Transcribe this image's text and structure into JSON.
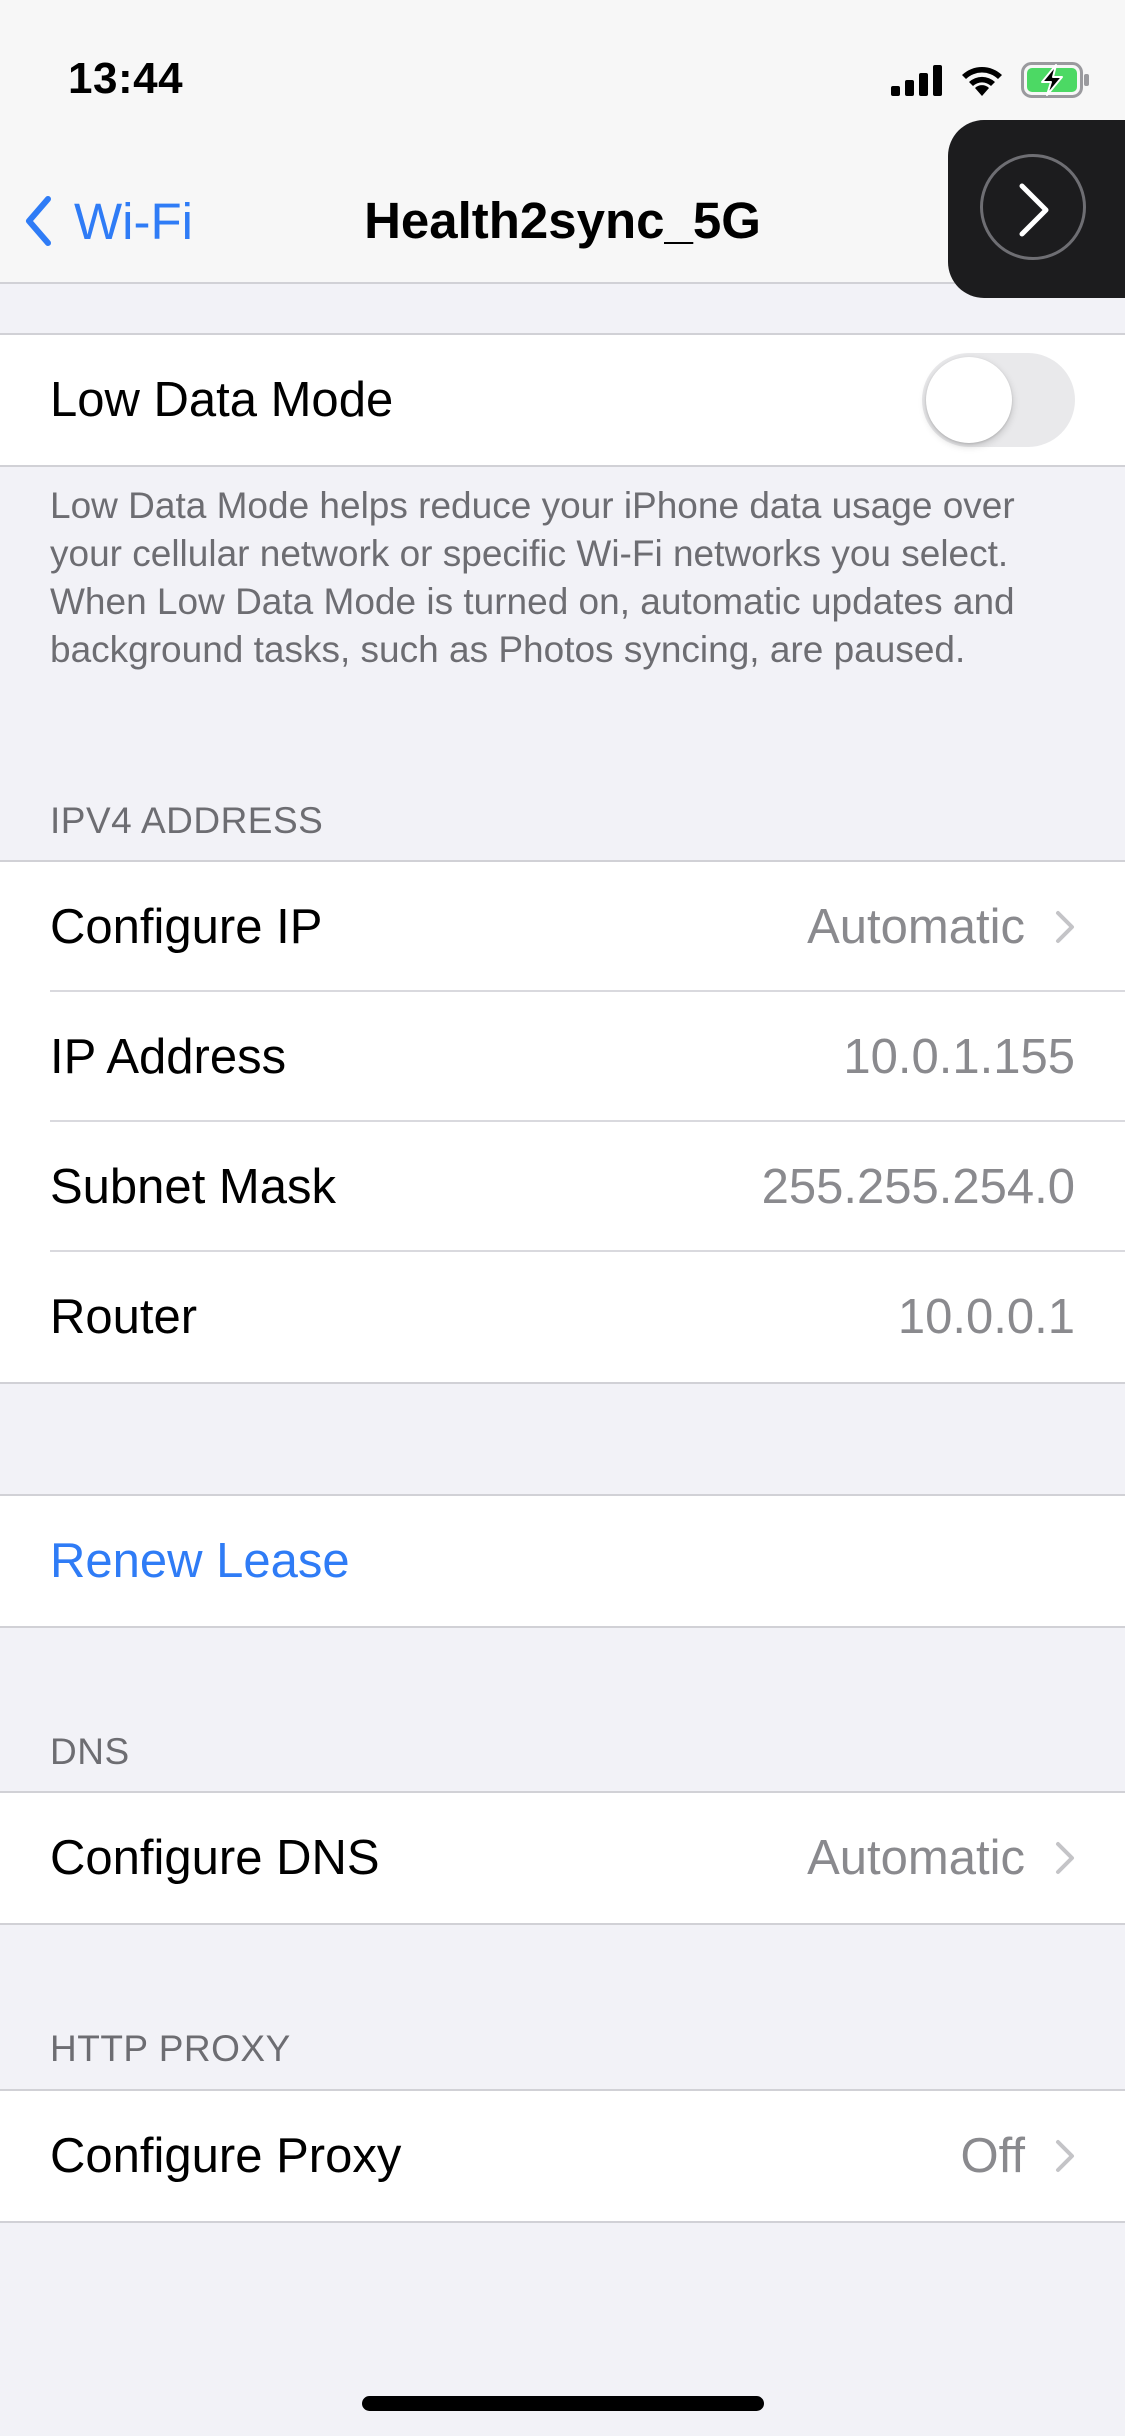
{
  "status_bar": {
    "time": "13:44",
    "icons": [
      "cellular-signal-icon",
      "wifi-icon",
      "battery-charging-icon"
    ]
  },
  "nav": {
    "back_label": "Wi-Fi",
    "title": "Health2sync_5G"
  },
  "low_data_mode": {
    "label": "Low Data Mode",
    "enabled": false,
    "footer": "Low Data Mode helps reduce your iPhone data usage over your cellular network or specific Wi-Fi networks you select. When Low Data Mode is turned on, automatic updates and background tasks, such as Photos syncing, are paused."
  },
  "ipv4": {
    "header": "IPV4 ADDRESS",
    "rows": [
      {
        "label": "Configure IP",
        "value": "Automatic"
      },
      {
        "label": "IP Address",
        "value": "10.0.1.155"
      },
      {
        "label": "Subnet Mask",
        "value": "255.255.254.0"
      },
      {
        "label": "Router",
        "value": "10.0.0.1"
      }
    ]
  },
  "renew": {
    "label": "Renew Lease"
  },
  "dns": {
    "header": "DNS",
    "label": "Configure DNS",
    "value": "Automatic"
  },
  "proxy": {
    "header": "HTTP PROXY",
    "label": "Configure Proxy",
    "value": "Off"
  },
  "colors": {
    "accent": "#2f7cf6",
    "background": "#f2f2f7",
    "secondary_text": "#8a8a8e",
    "battery_charging": "#4cd964"
  }
}
